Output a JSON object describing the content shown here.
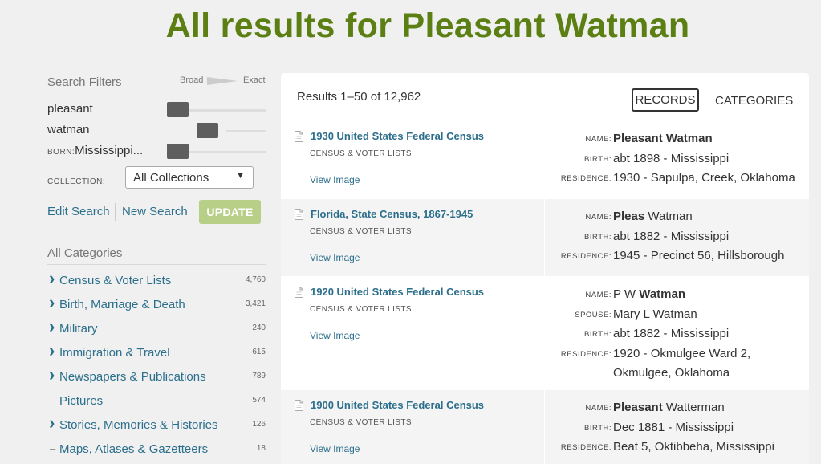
{
  "page_title": "All results for Pleasant Watman",
  "filters": {
    "title": "Search Filters",
    "broad_label": "Broad",
    "exact_label": "Exact",
    "rows": [
      {
        "label": "pleasant",
        "born_prefix": "",
        "level": 0
      },
      {
        "label": "watman",
        "born_prefix": "",
        "level": 0.5
      },
      {
        "label": "Mississippi...",
        "born_prefix": "BORN:",
        "level": 0
      }
    ],
    "collection_label": "COLLECTION:",
    "collection_value": "All Collections",
    "edit_search": "Edit Search",
    "new_search": "New Search",
    "update": "UPDATE"
  },
  "categories": {
    "title": "All Categories",
    "items": [
      {
        "name": "Census & Voter Lists",
        "count": "4,760",
        "expandable": true
      },
      {
        "name": "Birth, Marriage & Death",
        "count": "3,421",
        "expandable": true
      },
      {
        "name": "Military",
        "count": "240",
        "expandable": true
      },
      {
        "name": "Immigration & Travel",
        "count": "615",
        "expandable": true
      },
      {
        "name": "Newspapers & Publications",
        "count": "789",
        "expandable": true
      },
      {
        "name": "Pictures",
        "count": "574",
        "expandable": false
      },
      {
        "name": "Stories, Memories & Histories",
        "count": "126",
        "expandable": true
      },
      {
        "name": "Maps, Atlases & Gazetteers",
        "count": "18",
        "expandable": false
      }
    ]
  },
  "results": {
    "count_text": "Results 1–50 of 12,962",
    "tab_records": "RECORDS",
    "tab_categories": "CATEGORIES",
    "records": [
      {
        "title": "1930 United States Federal Census",
        "category": "CENSUS & VOTER LISTS",
        "view": "View Image",
        "height": 96,
        "fields": [
          {
            "label": "NAME:",
            "value_bold": "Pleasant Watman",
            "value": "",
            "value2": ""
          },
          {
            "label": "BIRTH:",
            "value_bold": "",
            "value": "abt 1898 - Mississippi",
            "value2": ""
          },
          {
            "label": "RESIDENCE:",
            "value_bold": "",
            "value": "1930 - Sapulpa, Creek, Oklahoma",
            "value2": ""
          }
        ]
      },
      {
        "title": "Florida, State Census, 1867-1945",
        "category": "CENSUS & VOTER LISTS",
        "view": "View Image",
        "height": 96,
        "fields": [
          {
            "label": "NAME:",
            "value_bold": "Pleas",
            "value": " Watman",
            "value2": ""
          },
          {
            "label": "BIRTH:",
            "value_bold": "",
            "value": "abt 1882 - Mississippi",
            "value2": ""
          },
          {
            "label": "RESIDENCE:",
            "value_bold": "",
            "value": "1945 - Precinct 56, Hillsborough",
            "value2": ""
          }
        ]
      },
      {
        "title": "1920 United States Federal Census",
        "category": "CENSUS & VOTER LISTS",
        "view": "View Image",
        "height": 140,
        "fields": [
          {
            "label": "NAME:",
            "value_bold": "",
            "value": "P W ",
            "value2": "Watman"
          },
          {
            "label": "SPOUSE:",
            "value_bold": "",
            "value": "Mary L Watman",
            "value2": ""
          },
          {
            "label": "BIRTH:",
            "value_bold": "",
            "value": "abt 1882 - Mississippi",
            "value2": ""
          },
          {
            "label": "RESIDENCE:",
            "value_bold": "",
            "value": "1920 - Okmulgee Ward 2,",
            "value2": ""
          },
          {
            "label": "",
            "value_bold": "",
            "value": "Okmulgee, Oklahoma",
            "value2": ""
          }
        ]
      },
      {
        "title": "1900 United States Federal Census",
        "category": "CENSUS & VOTER LISTS",
        "view": "View Image",
        "height": 100,
        "fields": [
          {
            "label": "NAME:",
            "value_bold": "Pleasant",
            "value": " Watterman",
            "value2": ""
          },
          {
            "label": "BIRTH:",
            "value_bold": "",
            "value": "Dec 1881 - Mississippi",
            "value2": ""
          },
          {
            "label": "RESIDENCE:",
            "value_bold": "",
            "value": "Beat 5, Oktibbeha, Mississippi",
            "value2": ""
          }
        ]
      }
    ]
  }
}
